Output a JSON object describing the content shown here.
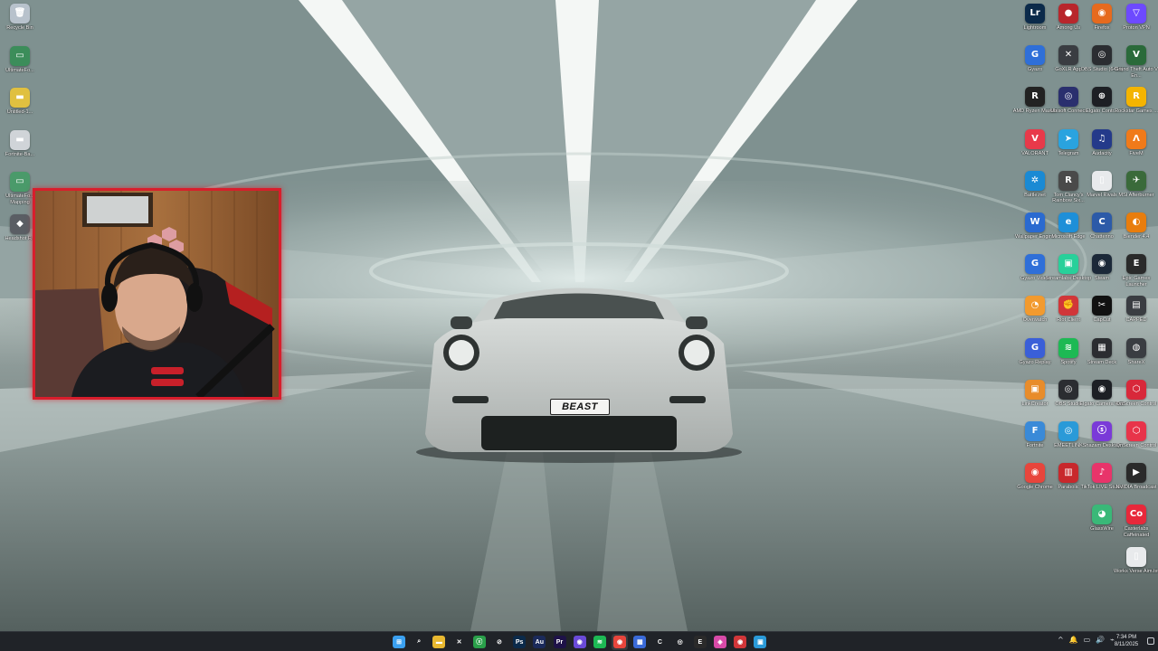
{
  "desktop_left": [
    {
      "id": "recycle",
      "label": "Recycle Bin",
      "icon": "recycle-bin-icon",
      "color": "#b8c2cc",
      "glyph": "🗑"
    },
    {
      "id": "ultimate1",
      "label": "UltimateFo...",
      "icon": "image-file-icon",
      "color": "#3c8d5a",
      "glyph": "▭"
    },
    {
      "id": "untitled",
      "label": "Untitled-1...",
      "icon": "file-icon",
      "color": "#e0c040",
      "glyph": "▬"
    },
    {
      "id": "fortnite-ba",
      "label": "Fortnite-Ba...",
      "icon": "file-icon",
      "color": "#d0d4d8",
      "glyph": "▬"
    },
    {
      "id": "ultimate2",
      "label": "UltimateFo... Mapping",
      "icon": "image-file-icon",
      "color": "#4a9a6a",
      "glyph": "▭"
    },
    {
      "id": "headshot",
      "label": "Headshot F...",
      "icon": "app-icon",
      "color": "#5a5e64",
      "glyph": "◆"
    }
  ],
  "desktop_right": [
    {
      "label": "Lightroom",
      "icon": "lightroom-icon",
      "color": "#0b2a4a",
      "glyph": "Lr"
    },
    {
      "label": "Among Us",
      "icon": "among-us-icon",
      "color": "#b8262c",
      "glyph": "●"
    },
    {
      "label": "Firefox",
      "icon": "firefox-icon",
      "color": "#e66a1e",
      "glyph": "◉"
    },
    {
      "label": "Proton VPN",
      "icon": "protonvpn-icon",
      "color": "#6d4aff",
      "glyph": "▽"
    },
    {
      "label": "Gyazo",
      "icon": "gyazo-icon",
      "color": "#2f6fd8",
      "glyph": "G"
    },
    {
      "label": "GoXLR App",
      "icon": "goxlr-icon",
      "color": "#3a3d42",
      "glyph": "✕"
    },
    {
      "label": "OBS Studio (64bit)",
      "icon": "obs-icon",
      "color": "#2b2d31",
      "glyph": "◎"
    },
    {
      "label": "Grand Theft Auto V En...",
      "icon": "gta-icon",
      "color": "#2a6a3a",
      "glyph": "V"
    },
    {
      "label": "AMD Ryzen Master",
      "icon": "amd-icon",
      "color": "#222",
      "glyph": "R"
    },
    {
      "label": "Ubisoft Connect",
      "icon": "ubisoft-icon",
      "color": "#2a2f6e",
      "glyph": "◎"
    },
    {
      "label": "Elgato Contr...",
      "icon": "elgato-icon",
      "color": "#1d1f24",
      "glyph": "⊕"
    },
    {
      "label": "Rockstar Games ...",
      "icon": "rockstar-icon",
      "color": "#f4b400",
      "glyph": "R"
    },
    {
      "label": "VALORANT",
      "icon": "valorant-icon",
      "color": "#e8394a",
      "glyph": "V"
    },
    {
      "label": "Telegram",
      "icon": "telegram-icon",
      "color": "#2aa3df",
      "glyph": "➤"
    },
    {
      "label": "Audacity",
      "icon": "audacity-icon",
      "color": "#243a8a",
      "glyph": "♫"
    },
    {
      "label": "FiveM",
      "icon": "fivem-icon",
      "color": "#f07a1a",
      "glyph": "Λ"
    },
    {
      "label": "Battle.net",
      "icon": "battlenet-icon",
      "color": "#1a8ad4",
      "glyph": "✲"
    },
    {
      "label": "Tom Clancy's Rainbow Six...",
      "icon": "rainbow-six-icon",
      "color": "#4a4a4a",
      "glyph": "R"
    },
    {
      "label": "Marvel Rivals",
      "icon": "marvel-rivals-icon",
      "color": "#e8eaec",
      "glyph": "▯"
    },
    {
      "label": "MSI Afterburner",
      "icon": "afterburner-icon",
      "color": "#3a6a3a",
      "glyph": "✈"
    },
    {
      "label": "Wallpaper Engine",
      "icon": "wallpaper-engine-icon",
      "color": "#2a6ad0",
      "glyph": "W"
    },
    {
      "label": "Microsoft Edge",
      "icon": "edge-icon",
      "color": "#1e8fd8",
      "glyph": "e"
    },
    {
      "label": "Chatterino",
      "icon": "chatterino-icon",
      "color": "#2c5aa8",
      "glyph": "C"
    },
    {
      "label": "Blender 4.4",
      "icon": "blender-icon",
      "color": "#e87d0d",
      "glyph": "◐"
    },
    {
      "label": "Gyazo Video",
      "icon": "gyazo-video-icon",
      "color": "#2f6fd8",
      "glyph": "G"
    },
    {
      "label": "Streamlabs Desktop",
      "icon": "streamlabs-icon",
      "color": "#28d09a",
      "glyph": "▣"
    },
    {
      "label": "Steam",
      "icon": "steam-icon",
      "color": "#1b2838",
      "glyph": "◉"
    },
    {
      "label": "Epic Games Launcher",
      "icon": "epic-games-icon",
      "color": "#2a2a2a",
      "glyph": "E"
    },
    {
      "label": "Overwatch",
      "icon": "overwatch-icon",
      "color": "#f29a2e",
      "glyph": "◔"
    },
    {
      "label": "Riot Client",
      "icon": "riot-client-icon",
      "color": "#d13639",
      "glyph": "✊"
    },
    {
      "label": "CapCut",
      "icon": "capcut-icon",
      "color": "#111",
      "glyph": "✂"
    },
    {
      "label": "CAPPED",
      "icon": "app-icon",
      "color": "#3a3d42",
      "glyph": "▤"
    },
    {
      "label": "Gyazo Replay",
      "icon": "gyazo-replay-icon",
      "color": "#3a5fd8",
      "glyph": "G"
    },
    {
      "label": "Spotify",
      "icon": "spotify-icon",
      "color": "#1db954",
      "glyph": "≋"
    },
    {
      "label": "Stream Deck",
      "icon": "stream-deck-icon",
      "color": "#2b2d31",
      "glyph": "▦"
    },
    {
      "label": "ShareX",
      "icon": "sharex-icon",
      "color": "#3a3d42",
      "glyph": "◍"
    },
    {
      "label": "LinkCreator",
      "icon": "app-icon",
      "color": "#e88c2a",
      "glyph": "▣"
    },
    {
      "label": "OBS Studio",
      "icon": "obs-icon",
      "color": "#2b2d31",
      "glyph": "◎"
    },
    {
      "label": "Elgato Camera Hub",
      "icon": "camera-hub-icon",
      "color": "#1d1f24",
      "glyph": "◉"
    },
    {
      "label": "OnScreen Control",
      "icon": "app-icon",
      "color": "#d8283a",
      "glyph": "⬡"
    },
    {
      "label": "Fortnite",
      "icon": "fortnite-icon",
      "color": "#3a8ad8",
      "glyph": "F"
    },
    {
      "label": "EMEETLINK",
      "icon": "emeet-icon",
      "color": "#2a9ad8",
      "glyph": "◎"
    },
    {
      "label": "Shazam Desktop",
      "icon": "app-icon",
      "color": "#7a3ad8",
      "glyph": "ⓢ"
    },
    {
      "label": "OnScreen Control",
      "icon": "app-icon",
      "color": "#e8344a",
      "glyph": "⬡"
    },
    {
      "label": "Google Chrome",
      "icon": "chrome-icon",
      "color": "#e8453c",
      "glyph": "◉"
    },
    {
      "label": "Parabolic",
      "icon": "parabolic-icon",
      "color": "#c8282c",
      "glyph": "▥"
    },
    {
      "label": "TikTok LIVE Studio",
      "icon": "tiktok-icon",
      "color": "#e8346a",
      "glyph": "♪"
    },
    {
      "label": "NVIDIA Broadcast",
      "icon": "nvidia-icon",
      "color": "#2a2a2a",
      "glyph": "▶"
    },
    {
      "label": "GlassWire",
      "icon": "glasswire-icon",
      "color": "#3ab878",
      "glyph": "◕"
    },
    {
      "label": "Casterlabs Caffeinated",
      "icon": "casterlabs-icon",
      "color": "#e8283a",
      "glyph": "Co"
    },
    {
      "label": "Works Verse Aim.txt",
      "icon": "text-file-icon",
      "color": "#e8eaec",
      "glyph": "▯"
    }
  ],
  "car": {
    "plate": "BEAST"
  },
  "taskbar": {
    "apps": [
      {
        "name": "start-button",
        "icon": "windows-icon",
        "color": "#3aa0f0",
        "glyph": "⊞"
      },
      {
        "name": "taskbar-search",
        "icon": "search-icon",
        "color": "transparent",
        "glyph": "⌕"
      },
      {
        "name": "taskbar-file-explorer",
        "icon": "folder-icon",
        "color": "#e8b830",
        "glyph": "▬"
      },
      {
        "name": "taskbar-app-x",
        "icon": "x-icon",
        "color": "transparent",
        "glyph": "✕"
      },
      {
        "name": "taskbar-xbox",
        "icon": "xbox-icon",
        "color": "#2aa04a",
        "glyph": "ⓧ"
      },
      {
        "name": "taskbar-obs",
        "icon": "obs-icon",
        "color": "transparent",
        "glyph": "⊘"
      },
      {
        "name": "taskbar-photoshop",
        "icon": "photoshop-icon",
        "color": "#0b2a4a",
        "glyph": "Ps"
      },
      {
        "name": "taskbar-audition",
        "icon": "audition-icon",
        "color": "#1b2a5a",
        "glyph": "Au"
      },
      {
        "name": "taskbar-premiere",
        "icon": "premiere-icon",
        "color": "#1e1248",
        "glyph": "Pr"
      },
      {
        "name": "taskbar-discord",
        "icon": "discord-icon",
        "color": "#6a4ad8",
        "glyph": "◉"
      },
      {
        "name": "taskbar-spotify",
        "icon": "spotify-icon",
        "color": "#1db954",
        "glyph": "≋"
      },
      {
        "name": "taskbar-chrome",
        "icon": "chrome-icon",
        "color": "#e8453c",
        "glyph": "◉"
      },
      {
        "name": "taskbar-app-window",
        "icon": "window-icon",
        "color": "#3a6ad8",
        "glyph": "▦"
      },
      {
        "name": "taskbar-chatterino",
        "icon": "chatterino-icon",
        "color": "transparent",
        "glyph": "C"
      },
      {
        "name": "taskbar-app-ring",
        "icon": "ring-icon",
        "color": "transparent",
        "glyph": "◎"
      },
      {
        "name": "taskbar-epic",
        "icon": "epic-games-icon",
        "color": "#2a2a2a",
        "glyph": "E"
      },
      {
        "name": "taskbar-app-colorful",
        "icon": "app-icon",
        "color": "#d84aa8",
        "glyph": "◈"
      },
      {
        "name": "taskbar-riot",
        "icon": "riot-client-icon",
        "color": "#d13639",
        "glyph": "◉"
      },
      {
        "name": "taskbar-app-blue",
        "icon": "app-icon",
        "color": "#2a9ad8",
        "glyph": "▣"
      }
    ],
    "tray_icons": [
      "^",
      "🔔",
      "▭",
      "🔊",
      "⌁"
    ],
    "time": "7:34 PM",
    "date": "8/11/2025"
  }
}
